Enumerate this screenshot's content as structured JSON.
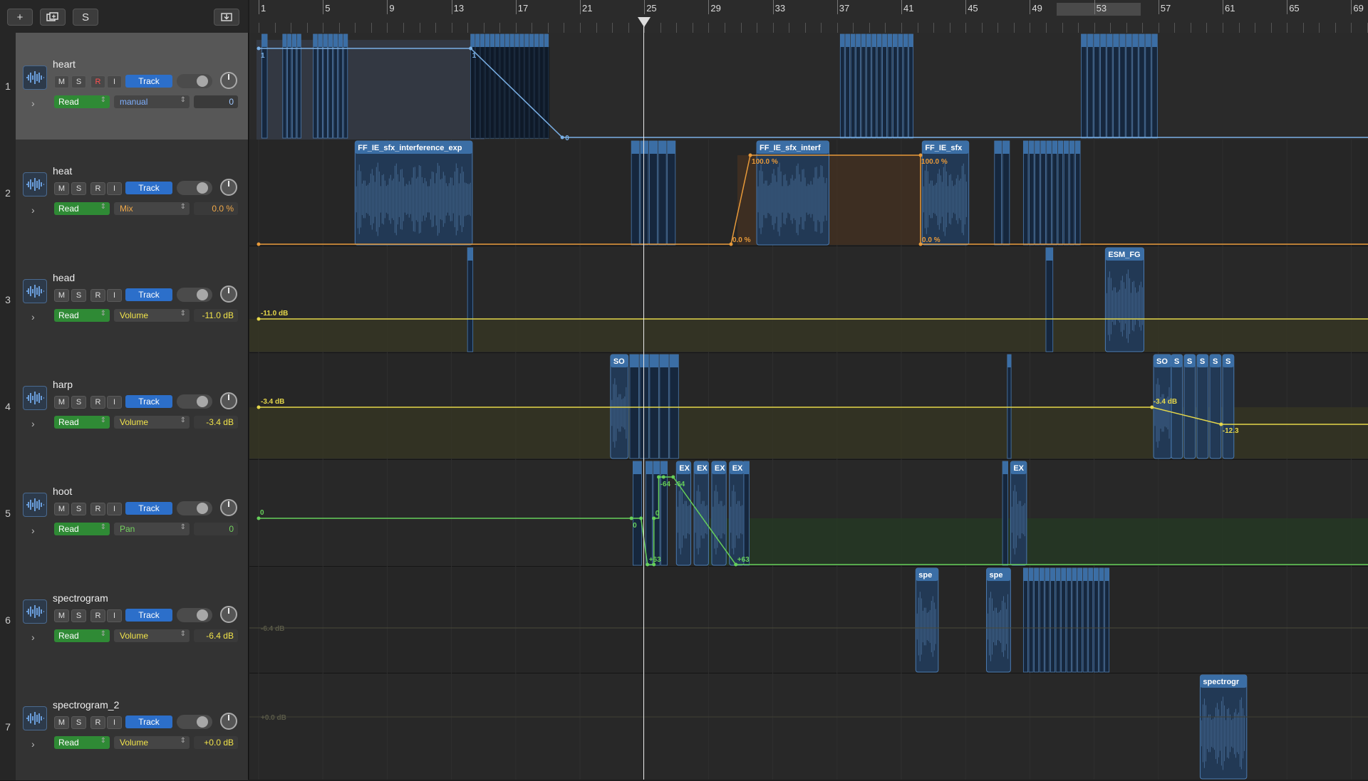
{
  "toolbar": {
    "add_label": "+",
    "duplicate_icon": "duplicate-track-icon",
    "s_label": "S",
    "download_icon": "tray-download-icon"
  },
  "ruler": {
    "bars": [
      1,
      5,
      9,
      13,
      17,
      21,
      25,
      29,
      33,
      37,
      41,
      45,
      49,
      53,
      57,
      61,
      65,
      69
    ]
  },
  "colors": {
    "accent_blue": "#2c6fca",
    "read_green": "#2f8a35",
    "region_blue": "#3b6ea5",
    "auto_blue": "#7ab0e6",
    "auto_orange": "#e89a3a",
    "auto_yellow": "#e5d74a",
    "auto_green": "#66d05a"
  },
  "tracks": [
    {
      "num": "1",
      "name": "heart",
      "m": "M",
      "s": "S",
      "r": "R",
      "i": "I",
      "track_btn": "Track",
      "read": "Read",
      "param": "manual",
      "value": "0",
      "value_color": "#9ec7ff",
      "param_color": "#7fb0ff",
      "selected": true
    },
    {
      "num": "2",
      "name": "heat",
      "m": "M",
      "s": "S",
      "r": "R",
      "i": "I",
      "track_btn": "Track",
      "read": "Read",
      "param": "Mix",
      "value": "0.0 %",
      "value_color": "#f0a848",
      "param_color": "#f0a848"
    },
    {
      "num": "3",
      "name": "head",
      "m": "M",
      "s": "S",
      "r": "R",
      "i": "I",
      "track_btn": "Track",
      "read": "Read",
      "param": "Volume",
      "value": "-11.0 dB",
      "value_color": "#f2e44a",
      "param_color": "#f2e44a"
    },
    {
      "num": "4",
      "name": "harp",
      "m": "M",
      "s": "S",
      "r": "R",
      "i": "I",
      "track_btn": "Track",
      "read": "Read",
      "param": "Volume",
      "value": "-3.4 dB",
      "value_color": "#f2e44a",
      "param_color": "#f2e44a"
    },
    {
      "num": "5",
      "name": "hoot",
      "m": "M",
      "s": "S",
      "r": "R",
      "i": "I",
      "track_btn": "Track",
      "read": "Read",
      "param": "Pan",
      "value": "0",
      "value_color": "#74d45f",
      "param_color": "#74d45f"
    },
    {
      "num": "6",
      "name": "spectrogram",
      "m": "M",
      "s": "S",
      "r": "R",
      "i": "I",
      "track_btn": "Track",
      "read": "Read",
      "param": "Volume",
      "value": "-6.4 dB",
      "value_color": "#f2e44a",
      "param_color": "#f2e44a"
    },
    {
      "num": "7",
      "name": "spectrogram_2",
      "m": "M",
      "s": "S",
      "r": "R",
      "i": "I",
      "track_btn": "Track",
      "read": "Read",
      "param": "Volume",
      "value": "+0.0 dB",
      "value_color": "#f2e44a",
      "param_color": "#f2e44a"
    }
  ],
  "region_labels": {
    "t2_r1": "FF_IE_sfx_interference_exp",
    "t2_r2": "FF_IE_sfx_interf",
    "t2_r3": "FF_IE_sfx",
    "t3_r1": "ESM_FG",
    "t4_r1": "SO",
    "t4_r2": "SO",
    "t4_s": "S",
    "t5_ex": "EX",
    "t6_r1": "spe",
    "t6_r2": "spe",
    "t7_r1": "spectrogr"
  },
  "automation_labels": {
    "t1_a": "1",
    "t1_b": "1",
    "t1_c": "0",
    "t2_a": "100.0 %",
    "t2_b": "0.0 %",
    "t2_c": "100.0 %",
    "t2_d": "0.0 %",
    "t3_a": "-11.0 dB",
    "t4_a": "-3.4 dB",
    "t4_b": "-3.4 dB",
    "t4_c": "-12.3",
    "t5_a": "0",
    "t5_b": "-64",
    "t5_c": "-64",
    "t5_d": "0",
    "t5_e": "0",
    "t5_f": "+63",
    "t5_g": "+63",
    "t6_a": "-6.4 dB",
    "t7_a": "+0.0 dB"
  }
}
